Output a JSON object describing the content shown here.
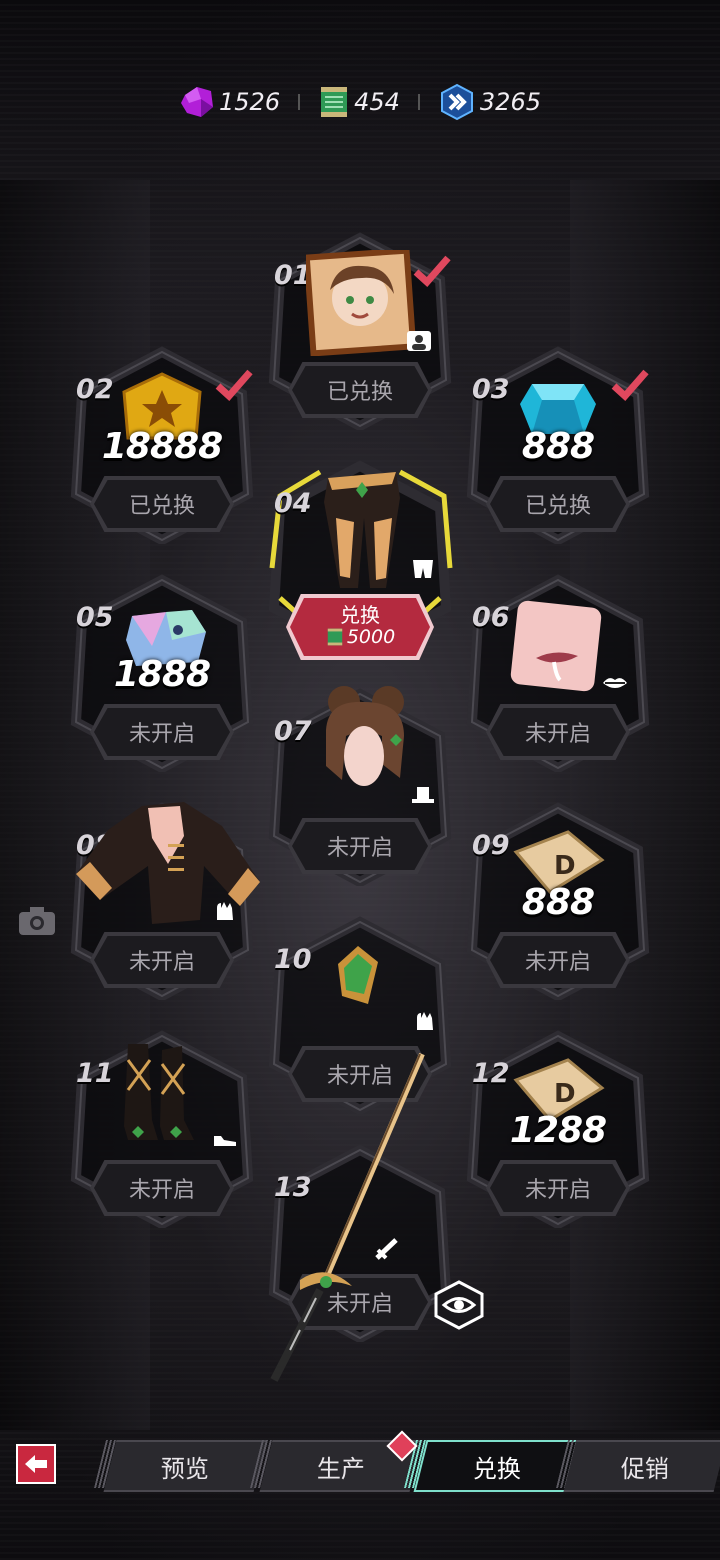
{
  "currencies": [
    {
      "icon": "purple-crystal-icon",
      "value": "1526"
    },
    {
      "icon": "green-ticket-icon",
      "value": "454"
    },
    {
      "icon": "blue-badge-icon",
      "value": "3265"
    }
  ],
  "slots": [
    {
      "num": "01",
      "status": "已兑换",
      "claimed": true,
      "item": "portrait-card",
      "category": "avatar-icon"
    },
    {
      "num": "02",
      "status": "已兑换",
      "claimed": true,
      "item": "gold-coin",
      "amount": "18888"
    },
    {
      "num": "03",
      "status": "已兑换",
      "claimed": true,
      "item": "blue-gem",
      "amount": "888"
    },
    {
      "num": "04",
      "button_label": "兑换",
      "cost": "5000",
      "item": "outfit-bottom",
      "category": "pants-icon"
    },
    {
      "num": "05",
      "status": "未开启",
      "item": "holo-ticket",
      "amount": "1888"
    },
    {
      "num": "06",
      "status": "未开启",
      "item": "mouth-sticker",
      "category": "lips-icon"
    },
    {
      "num": "07",
      "status": "未开启",
      "item": "hair-bun",
      "category": "hat-icon"
    },
    {
      "num": "08",
      "status": "未开启",
      "item": "jacket-top",
      "category": "glove-icon"
    },
    {
      "num": "09",
      "status": "未开启",
      "item": "d-ticket",
      "amount": "888"
    },
    {
      "num": "10",
      "status": "未开启",
      "item": "green-earring",
      "category": "glove-icon"
    },
    {
      "num": "11",
      "status": "未开启",
      "item": "boots",
      "category": "shoe-icon"
    },
    {
      "num": "12",
      "status": "未开启",
      "item": "d-ticket",
      "amount": "1288"
    },
    {
      "num": "13",
      "status": "未开启",
      "item": "sword",
      "category": "sword-icon"
    }
  ],
  "nav": {
    "tabs": [
      "预览",
      "生产",
      "兑换",
      "促销"
    ],
    "active": "兑换"
  },
  "colors": {
    "accent": "#c9283f",
    "active_tab": "#7fe0cc",
    "highlight": "#e7d93a"
  }
}
